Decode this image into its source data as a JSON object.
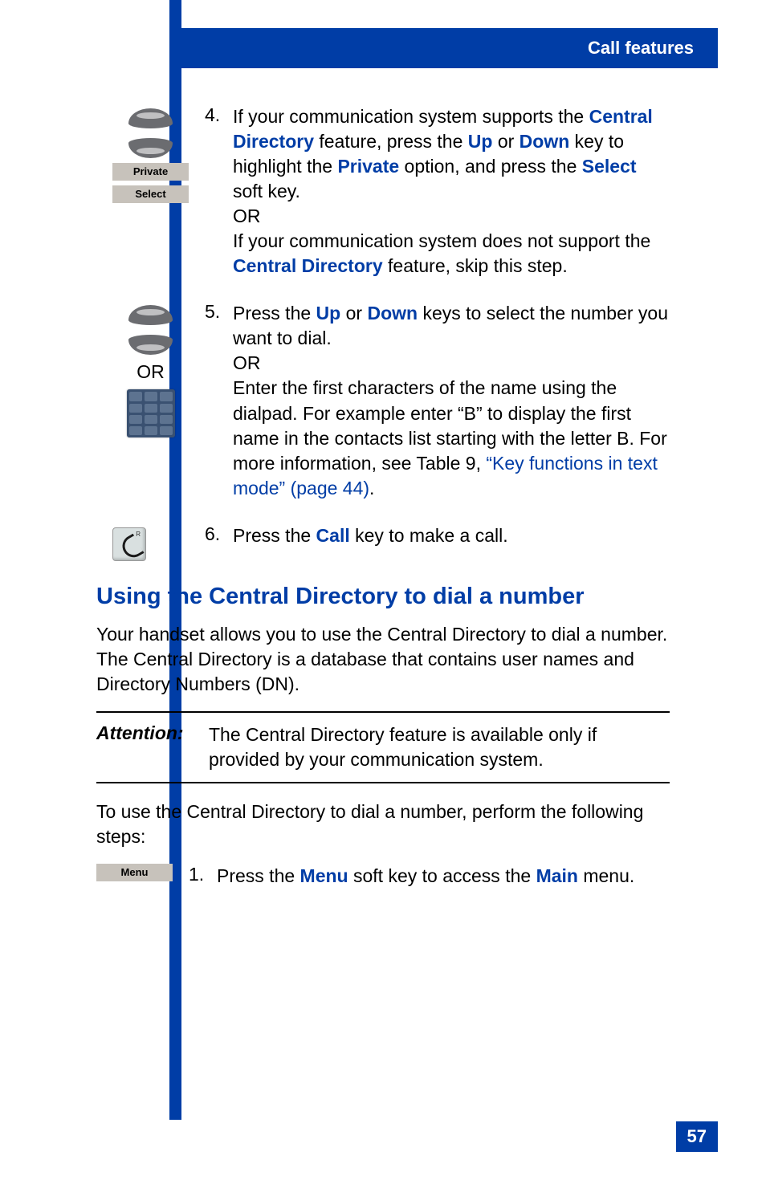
{
  "header": {
    "title": "Call features"
  },
  "step4": {
    "num": "4.",
    "t1": "If your communication system supports the ",
    "central_dir": "Central Directory",
    "t2": " feature, press the ",
    "up": "Up",
    "t3": " or ",
    "down": "Down",
    "t4": " key to highlight the ",
    "private": "Private",
    "t5": " option, and press the ",
    "select": "Select",
    "t6": " soft key.",
    "or": "OR",
    "t7": "If your communication system does not support the ",
    "central_dir2": "Central Directory",
    "t8": " feature, skip this step.",
    "sk_private": "Private",
    "sk_select": "Select"
  },
  "step5": {
    "num": "5.",
    "t1": "Press the ",
    "up": "Up",
    "t2": " or ",
    "down": "Down",
    "t3": " keys to select the number you want to dial.",
    "or": "OR",
    "t4": "Enter the first characters of the name using the dialpad. For example enter “B” to display the first name in the contacts list starting with the letter B. For more information, see Table 9, ",
    "xref": "“Key functions in text mode” (page 44)",
    "t5": ".",
    "icon_or": "OR"
  },
  "step6": {
    "num": "6.",
    "t1": "Press the ",
    "call": "Call",
    "t2": " key to make a call."
  },
  "section": {
    "heading": "Using the Central Directory to dial a number",
    "para": "Your handset allows you to use the Central Directory to dial a number. The Central Directory is a database that contains user names and Directory Numbers (DN).",
    "attn_label": "Attention:",
    "attn_text": "The Central Directory feature is available only if provided by your communication system.",
    "lead": "To use the Central Directory to dial a number, perform the following steps:"
  },
  "step1": {
    "sk_menu": "Menu",
    "num": "1.",
    "t1": "Press the ",
    "menu": "Menu",
    "t2": " soft key to access the ",
    "main": "Main",
    "t3": " menu."
  },
  "page_num": "57"
}
